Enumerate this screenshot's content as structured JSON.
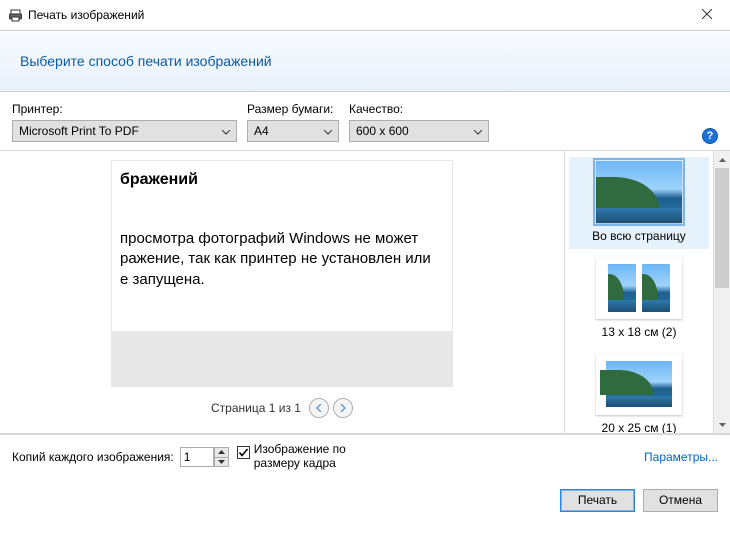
{
  "titlebar": {
    "title": "Печать изображений"
  },
  "banner": {
    "heading": "Выберите способ печати изображений"
  },
  "controls": {
    "printer": {
      "label": "Принтер:",
      "value": "Microsoft Print To PDF"
    },
    "paper": {
      "label": "Размер бумаги:",
      "value": "A4"
    },
    "quality": {
      "label": "Качество:",
      "value": "600 x 600"
    }
  },
  "preview": {
    "fragment_heading": "бражений",
    "fragment_line1": "  просмотра фотографий Windows не может",
    "fragment_line2": "ражение, так как принтер не установлен или",
    "fragment_line3": "е запущена.",
    "pager": "Страница 1 из 1"
  },
  "layouts": [
    {
      "label": "Во всю страницу",
      "kind": "full",
      "selected": true
    },
    {
      "label": "13 x 18 см (2)",
      "kind": "two",
      "selected": false
    },
    {
      "label": "20 x 25 см (1)",
      "kind": "one",
      "selected": false
    }
  ],
  "bottom": {
    "copies_label": "Копий каждого изображения:",
    "copies_value": "1",
    "fit_label": "Изображение по размеру кадра",
    "fit_checked": true,
    "options_link": "Параметры..."
  },
  "footer": {
    "print": "Печать",
    "cancel": "Отмена"
  }
}
